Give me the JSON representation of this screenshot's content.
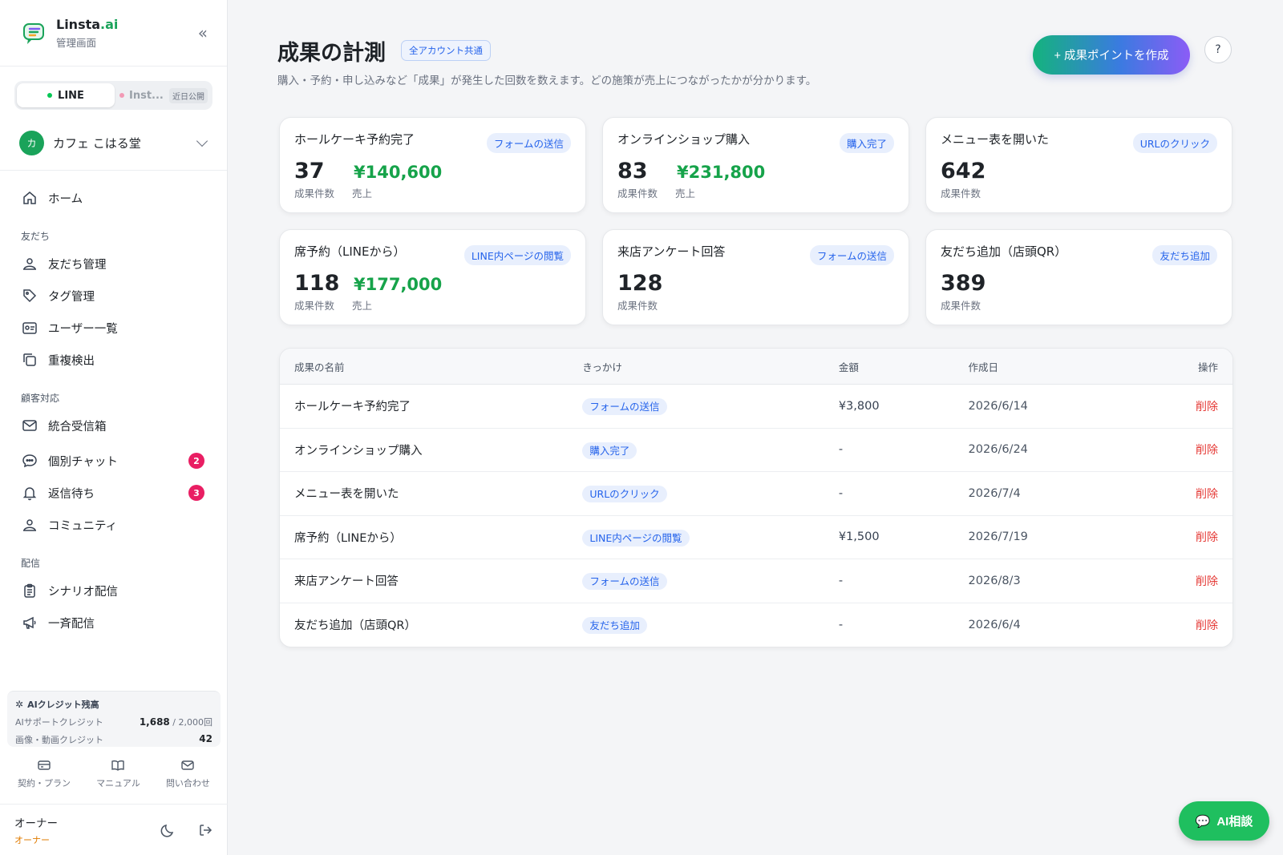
{
  "brand": {
    "name": "Linsta",
    "name_suffix": ".ai",
    "subtitle": "管理画面"
  },
  "channels": {
    "line": "LINE",
    "instagram": "Inst...",
    "instagram_badge": "近日公開"
  },
  "account": {
    "avatar_initial": "カ",
    "name": "カフェ こはる堂"
  },
  "nav": {
    "home": "ホーム",
    "sections": {
      "friends": "友だち",
      "support": "顧客対応",
      "delivery": "配信"
    },
    "friends_items": [
      "友だち管理",
      "タグ管理",
      "ユーザー一覧",
      "重複検出"
    ],
    "support_items": [
      {
        "label": "統合受信箱",
        "badge": ""
      },
      {
        "label": "個別チャット",
        "badge": "2"
      },
      {
        "label": "返信待ち",
        "badge": "3"
      },
      {
        "label": "コミュニティ",
        "badge": ""
      }
    ],
    "delivery_items": [
      "シナリオ配信",
      "一斉配信"
    ]
  },
  "credits": {
    "title": "AIクレジット残高",
    "support_label": "AIサポートクレジット",
    "support_value": "1,688",
    "support_total": "/ 2,000回",
    "media_label": "画像・動画クレジット",
    "media_value": "42"
  },
  "footer_links": {
    "contract": "契約・プラン",
    "manual": "マニュアル",
    "contact": "問い合わせ"
  },
  "owner": {
    "name": "オーナー",
    "role": "オーナー"
  },
  "page": {
    "title": "成果の計測",
    "scope_badge": "全アカウント共通",
    "description": "購入・予約・申し込みなど「成果」が発生した回数を数えます。どの施策が売上につながったかが分かります。",
    "create_button": "+ 成果ポイントを作成",
    "help": "?"
  },
  "cards": [
    {
      "title": "ホールケーキ予約完了",
      "tag": "フォームの送信",
      "count": "37",
      "sales": "¥140,600",
      "count_label": "成果件数",
      "sales_label": "売上"
    },
    {
      "title": "オンラインショップ購入",
      "tag": "購入完了",
      "count": "83",
      "sales": "¥231,800",
      "count_label": "成果件数",
      "sales_label": "売上"
    },
    {
      "title": "メニュー表を開いた",
      "tag": "URLのクリック",
      "count": "642",
      "sales": "",
      "count_label": "成果件数",
      "sales_label": ""
    },
    {
      "title": "席予約（LINEから）",
      "tag": "LINE内ページの閲覧",
      "count": "118",
      "sales": "¥177,000",
      "count_label": "成果件数",
      "sales_label": "売上"
    },
    {
      "title": "来店アンケート回答",
      "tag": "フォームの送信",
      "count": "128",
      "sales": "",
      "count_label": "成果件数",
      "sales_label": ""
    },
    {
      "title": "友だち追加（店頭QR）",
      "tag": "友だち追加",
      "count": "389",
      "sales": "",
      "count_label": "成果件数",
      "sales_label": ""
    }
  ],
  "table": {
    "headers": [
      "成果の名前",
      "きっかけ",
      "金額",
      "作成日",
      "操作"
    ],
    "rows": [
      {
        "name": "ホールケーキ予約完了",
        "trigger": "フォームの送信",
        "amount": "¥3,800",
        "date": "2026/6/14",
        "action": "削除"
      },
      {
        "name": "オンラインショップ購入",
        "trigger": "購入完了",
        "amount": "-",
        "date": "2026/6/24",
        "action": "削除"
      },
      {
        "name": "メニュー表を開いた",
        "trigger": "URLのクリック",
        "amount": "-",
        "date": "2026/7/4",
        "action": "削除"
      },
      {
        "name": "席予約（LINEから）",
        "trigger": "LINE内ページの閲覧",
        "amount": "¥1,500",
        "date": "2026/7/19",
        "action": "削除"
      },
      {
        "name": "来店アンケート回答",
        "trigger": "フォームの送信",
        "amount": "-",
        "date": "2026/8/3",
        "action": "削除"
      },
      {
        "name": "友だち追加（店頭QR）",
        "trigger": "友だち追加",
        "amount": "-",
        "date": "2026/6/4",
        "action": "削除"
      }
    ]
  },
  "ai_chat": {
    "label": "AI相談"
  },
  "colors": {
    "brand_green": "#1aa35a",
    "line_green": "#06c755",
    "link_blue": "#2563eb",
    "danger": "#e53935",
    "sales_green": "#16a34a"
  }
}
